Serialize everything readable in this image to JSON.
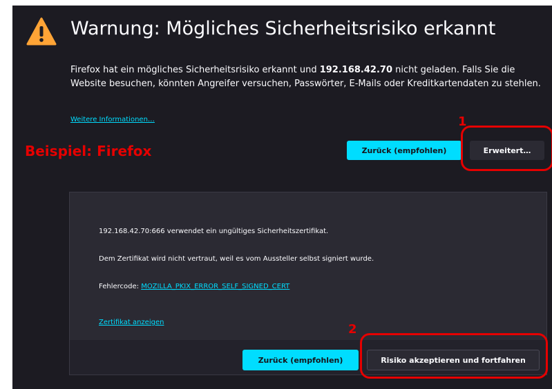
{
  "icons": {
    "warning": "warning-triangle-icon"
  },
  "title": "Warnung: Mögliches Sicherheitsrisiko erkannt",
  "body": {
    "before": "Firefox hat ein mögliches Sicherheitsrisiko erkannt und ",
    "host": "192.168.42.70",
    "after": " nicht geladen. Falls Sie die Website besuchen, könnten Angreifer versuchen, Passwörter, E-Mails oder Kreditkartendaten zu stehlen."
  },
  "more_info": "Weitere Informationen…",
  "annotation": {
    "label": "Beispiel:  Firefox",
    "num1": "1",
    "num2": "2",
    "color": "#e60000"
  },
  "buttons": {
    "back_recommended": "Zurück (empfohlen)",
    "advanced": "Erweitert…",
    "accept_risk": "Risiko akzeptieren und fortfahren"
  },
  "advanced_panel": {
    "line1": "192.168.42.70:666 verwendet ein ungültiges Sicherheitszertifikat.",
    "line2": "Dem Zertifikat wird nicht vertraut, weil es vom Aussteller selbst signiert wurde.",
    "error_prefix": "Fehlercode: ",
    "error_code": "MOZILLA_PKIX_ERROR_SELF_SIGNED_CERT",
    "view_cert": "Zertifikat anzeigen"
  },
  "colors": {
    "background": "#1c1b22",
    "accent": "#00ddff",
    "warning": "#ffa436",
    "panel": "#2b2a33"
  }
}
